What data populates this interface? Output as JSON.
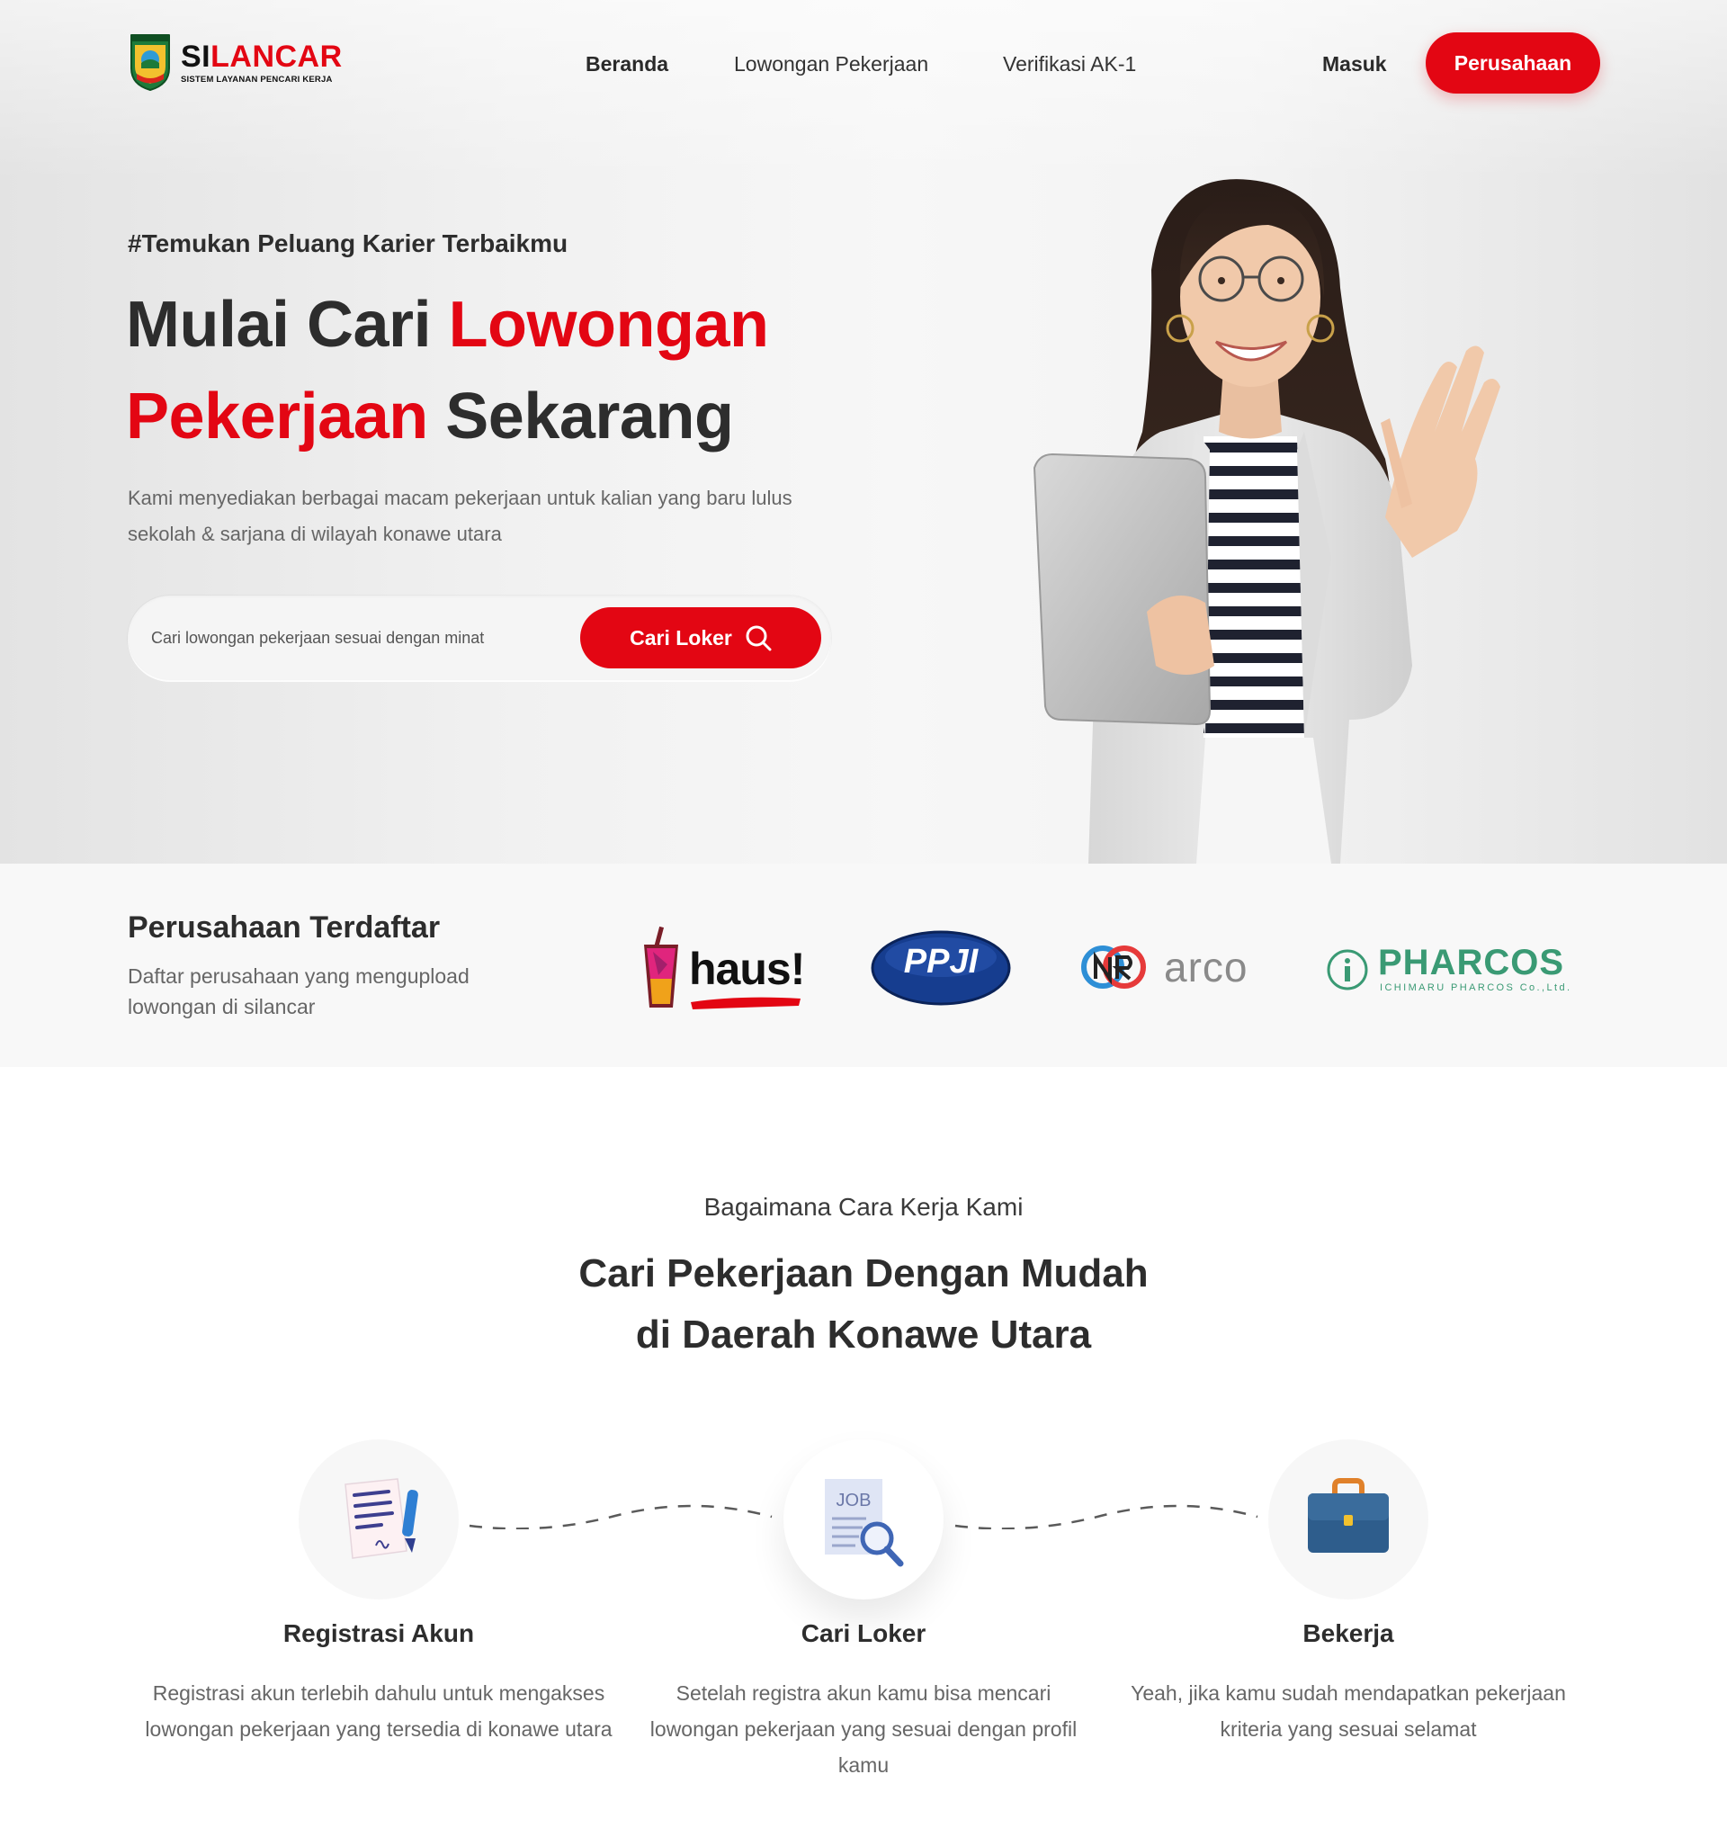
{
  "nav": {
    "logo_word_a": "SI",
    "logo_word_b": "LANCAR",
    "logo_sub": "SISTEM LAYANAN PENCARI KERJA",
    "links": [
      "Beranda",
      "Lowongan Pekerjaan",
      "Verifikasi AK-1"
    ],
    "login": "Masuk",
    "company_button": "Perusahaan"
  },
  "hero": {
    "tagline": "#Temukan Peluang Karier Terbaikmu",
    "headline": {
      "part1": "Mulai Cari ",
      "part2": "Lowongan",
      "part3": "Pekerjaan",
      "part4": " Sekarang"
    },
    "description": "Kami menyediakan berbagai macam pekerjaan untuk kalian yang baru lulus sekolah & sarjana di wilayah konawe utara",
    "search_placeholder": "Cari lowongan pekerjaan sesuai dengan minat",
    "search_button": "Cari Loker"
  },
  "companies": {
    "title": "Perusahaan Terdaftar",
    "description": "Daftar perusahaan yang mengupload lowongan di silancar",
    "logos": {
      "haus": "haus!",
      "ppji": "PPJI",
      "arco": "arco",
      "pharcos": "PHARCOS",
      "pharcos_sub": "ICHIMARU PHARCOS Co.,Ltd."
    }
  },
  "how": {
    "kicker": "Bagaimana Cara Kerja Kami",
    "title_line1": "Cari Pekerjaan Dengan Mudah",
    "title_line2": "di Daerah Konawe Utara",
    "steps": [
      {
        "title": "Registrasi Akun",
        "description": "Registrasi akun terlebih dahulu untuk mengakses lowongan pekerjaan yang tersedia di konawe utara"
      },
      {
        "title": "Cari Loker",
        "description": "Setelah registra akun kamu bisa mencari  lowongan pekerjaan yang sesuai dengan profil kamu"
      },
      {
        "title": "Bekerja",
        "description": "Yeah, jika kamu sudah mendapatkan pekerjaan kriteria yang sesuai selamat"
      }
    ],
    "job_icon_label": "JOB"
  },
  "colors": {
    "accent": "#e30613",
    "text": "#2d2d2d",
    "muted": "#666666"
  }
}
